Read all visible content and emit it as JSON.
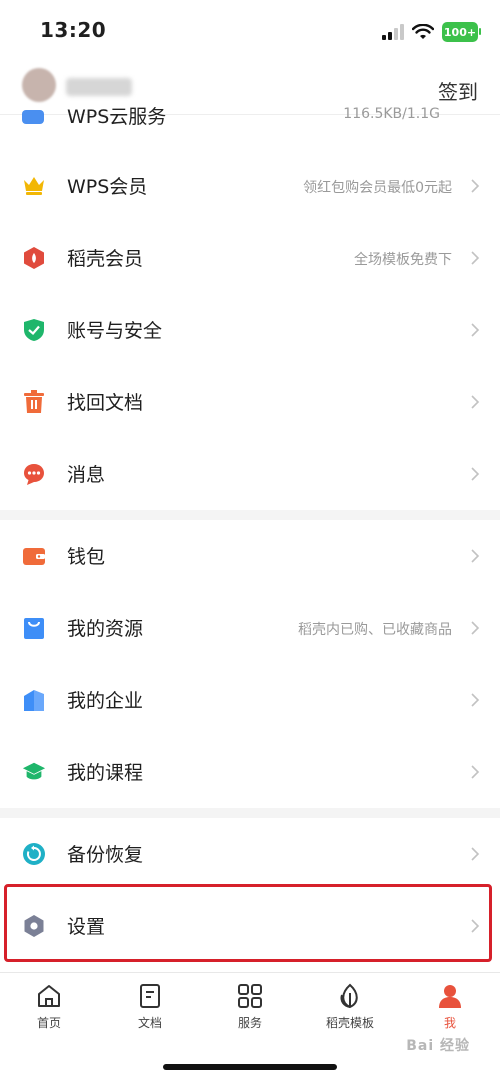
{
  "status": {
    "time": "13:20",
    "battery": "100+"
  },
  "header": {
    "checkin_label": "签到"
  },
  "cloud_row": {
    "label": "WPS云服务",
    "value": "116.5KB/1.1G"
  },
  "menu": {
    "group1": [
      {
        "label": "WPS会员",
        "sub": "领红包购会员最低0元起",
        "icon": "crown-icon",
        "color": "#f2b705"
      },
      {
        "label": "稻壳会员",
        "sub": "全场模板免费下",
        "icon": "shell-icon",
        "color": "#e04b3d"
      },
      {
        "label": "账号与安全",
        "sub": "",
        "icon": "shield-icon",
        "color": "#1fb66b"
      },
      {
        "label": "找回文档",
        "sub": "",
        "icon": "trash-icon",
        "color": "#f06b3a"
      },
      {
        "label": "消息",
        "sub": "",
        "icon": "message-icon",
        "color": "#e8523c"
      }
    ],
    "group2": [
      {
        "label": "钱包",
        "sub": "",
        "icon": "wallet-icon",
        "color": "#f06b3a"
      },
      {
        "label": "我的资源",
        "sub": "稻壳内已购、已收藏商品",
        "icon": "bag-icon",
        "color": "#3e8ef7"
      },
      {
        "label": "我的企业",
        "sub": "",
        "icon": "building-icon",
        "color": "#3e8ef7"
      },
      {
        "label": "我的课程",
        "sub": "",
        "icon": "graduation-icon",
        "color": "#1fb66b"
      }
    ],
    "group3": [
      {
        "label": "备份恢复",
        "sub": "",
        "icon": "backup-icon",
        "color": "#1fb0c6"
      },
      {
        "label": "设置",
        "sub": "",
        "icon": "settings-icon",
        "color": "#7b8096"
      }
    ]
  },
  "bottom_nav": [
    {
      "label": "首页",
      "icon": "home-icon"
    },
    {
      "label": "文档",
      "icon": "document-icon"
    },
    {
      "label": "服务",
      "icon": "grid-icon"
    },
    {
      "label": "稻壳模板",
      "icon": "leaf-icon"
    },
    {
      "label": "我",
      "icon": "person-icon",
      "active": true
    }
  ],
  "watermark": "Bai 经验"
}
